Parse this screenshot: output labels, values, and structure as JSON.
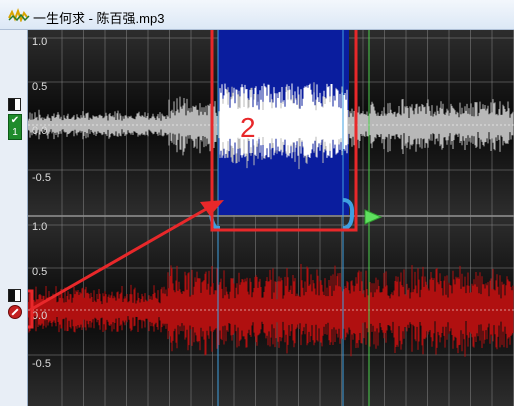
{
  "window": {
    "title": "一生何求 - 陈百强.mp3"
  },
  "tracks": [
    {
      "name": "left-channel",
      "ticks": [
        "1.0",
        "0.5",
        "0.0",
        "-0.5"
      ],
      "wave_color": "#b8b8b8",
      "badge": "1"
    },
    {
      "name": "right-channel",
      "ticks": [
        "1.0",
        "0.5",
        "0.0",
        "-0.5"
      ],
      "wave_color": "#b01010"
    }
  ],
  "annotations": {
    "label_1": "1",
    "label_2": "2",
    "color": "#e8282a"
  },
  "selection": {
    "color": "#0a1d9e"
  }
}
